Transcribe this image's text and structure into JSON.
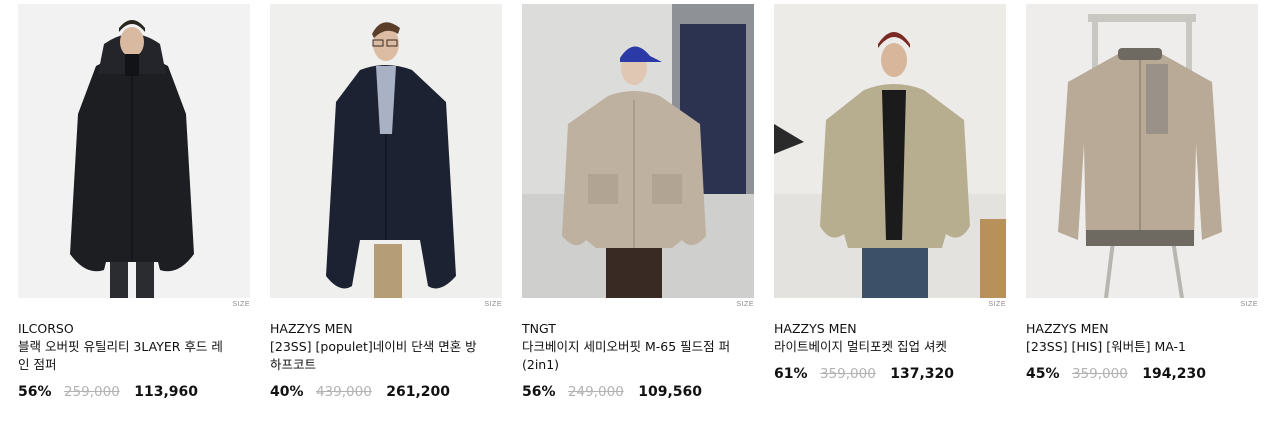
{
  "products": [
    {
      "size_label": "SIZE",
      "brand": "ILCORSO",
      "name": "블랙 오버핏 유틸리티 3LAYER 후드 레인 점퍼",
      "discount": "56%",
      "original_price": "259,000",
      "sale_price": "113,960"
    },
    {
      "size_label": "SIZE",
      "brand": "HAZZYS MEN",
      "name": "[23SS] [populet]네이비 단색 면혼 방 하프코트",
      "discount": "40%",
      "original_price": "439,000",
      "sale_price": "261,200"
    },
    {
      "size_label": "SIZE",
      "brand": "TNGT",
      "name": "다크베이지 세미오버핏 M-65 필드점 퍼 (2in1)",
      "discount": "56%",
      "original_price": "249,000",
      "sale_price": "109,560"
    },
    {
      "size_label": "SIZE",
      "brand": "HAZZYS MEN",
      "name": "라이트베이지 멀티포켓 집업 셔켓",
      "discount": "61%",
      "original_price": "359,000",
      "sale_price": "137,320"
    },
    {
      "size_label": "SIZE",
      "brand": "HAZZYS MEN",
      "name": "[23SS] [HIS] [워버튼] MA-1",
      "discount": "45%",
      "original_price": "359,000",
      "sale_price": "194,230"
    }
  ]
}
